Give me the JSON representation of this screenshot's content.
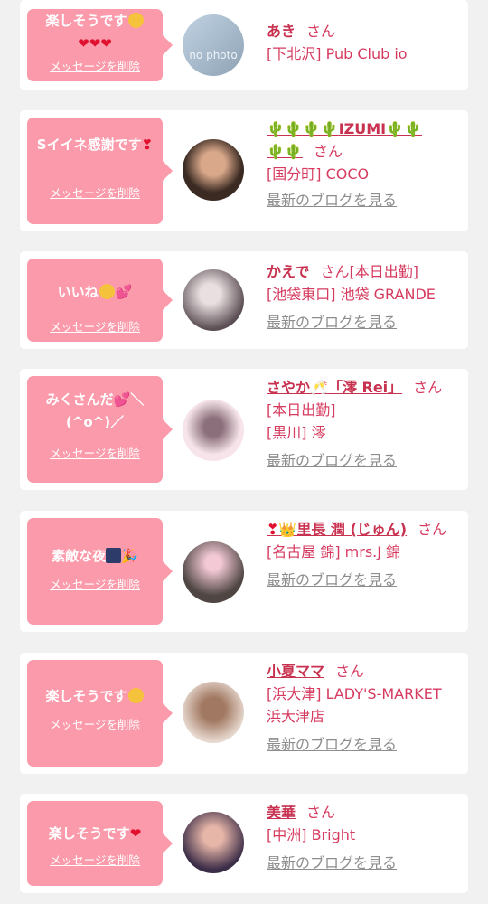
{
  "delete_label": "メッセージを削除",
  "blog_label": "最新のブログを見る",
  "san_label": "さん",
  "messages": [
    {
      "text": "楽しそうです",
      "name": "あき",
      "shop": "[下北沢] Pub Club io",
      "avatar_text": "no photo"
    },
    {
      "text": "Sイイネ感謝です",
      "name": "IZUMI",
      "shop": "[国分町] COCO"
    },
    {
      "text": "いいね",
      "name": "かえで",
      "status": "[本日出勤]",
      "shop": "[池袋東口] 池袋 GRANDE"
    },
    {
      "text": "みくさんだ",
      "text2": "(^o^)／",
      "name": "さやか",
      "name2": "「澪 Rei」",
      "status": "[本日出勤]",
      "shop": "[黒川] 澪"
    },
    {
      "text": "素敵な夜",
      "name": "里長 潤 (じゅん)",
      "shop": "[名古屋 錦] mrs.J 錦"
    },
    {
      "text": "楽しそうです",
      "name": "小夏ママ",
      "shop": "[浜大津] LADY'S-MARKET 浜大津店"
    },
    {
      "text": "楽しそうです",
      "name": "美華",
      "shop": "[中洲] Bright"
    }
  ],
  "colors": {
    "bubble": "#fb9aaa",
    "name": "#c8314f",
    "link_gray": "#8d8d8d"
  }
}
